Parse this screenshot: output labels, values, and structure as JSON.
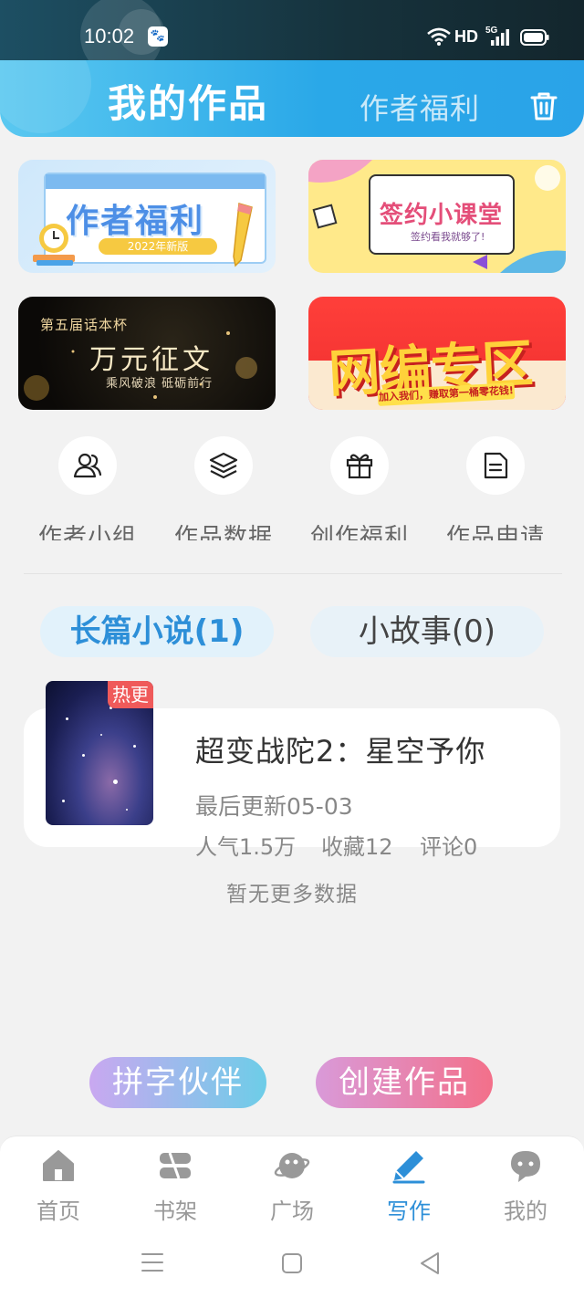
{
  "status_bar": {
    "time": "10:02",
    "app_badge": "🐾",
    "network": "HD",
    "signal": "5G"
  },
  "header": {
    "active_tab": "我的作品",
    "inactive_tab": "作者福利",
    "delete_icon": "trash-icon"
  },
  "banners": [
    {
      "title": "作者福利",
      "subtitle": "2022年新版"
    },
    {
      "title": "签约小课堂",
      "subtitle": "签约看我就够了!"
    },
    {
      "kicker": "第五届话本杯",
      "title": "万元征文",
      "subtitle": "乘风破浪 砥砺前行"
    },
    {
      "title": "网编专区",
      "subtitle": "加入我们，赚取第一桶零花钱!"
    }
  ],
  "quick_menu": [
    {
      "label": "作者小组",
      "icon": "users-icon"
    },
    {
      "label": "作品数据",
      "icon": "layers-icon"
    },
    {
      "label": "创作福利",
      "icon": "gift-icon"
    },
    {
      "label": "作品申请",
      "icon": "document-icon"
    }
  ],
  "type_tabs": {
    "novel": "长篇小说(1)",
    "story": "小故事(0)"
  },
  "work": {
    "tag": "热更",
    "title": "超变战陀2：星空予你",
    "updated": "最后更新05-03",
    "popularity": "人气1.5万",
    "favorites": "收藏12",
    "comments": "评论0"
  },
  "no_more": "暂无更多数据",
  "actions": {
    "partner": "拼字伙伴",
    "create": "创建作品"
  },
  "bottom_nav": [
    {
      "label": "首页",
      "icon": "home-icon"
    },
    {
      "label": "书架",
      "icon": "bookshelf-icon"
    },
    {
      "label": "广场",
      "icon": "planet-icon"
    },
    {
      "label": "写作",
      "icon": "pen-icon"
    },
    {
      "label": "我的",
      "icon": "chat-icon"
    }
  ],
  "colors": {
    "accent": "#2d8fd8",
    "header": "#2aa8e8",
    "hot": "#ef5a5a"
  }
}
